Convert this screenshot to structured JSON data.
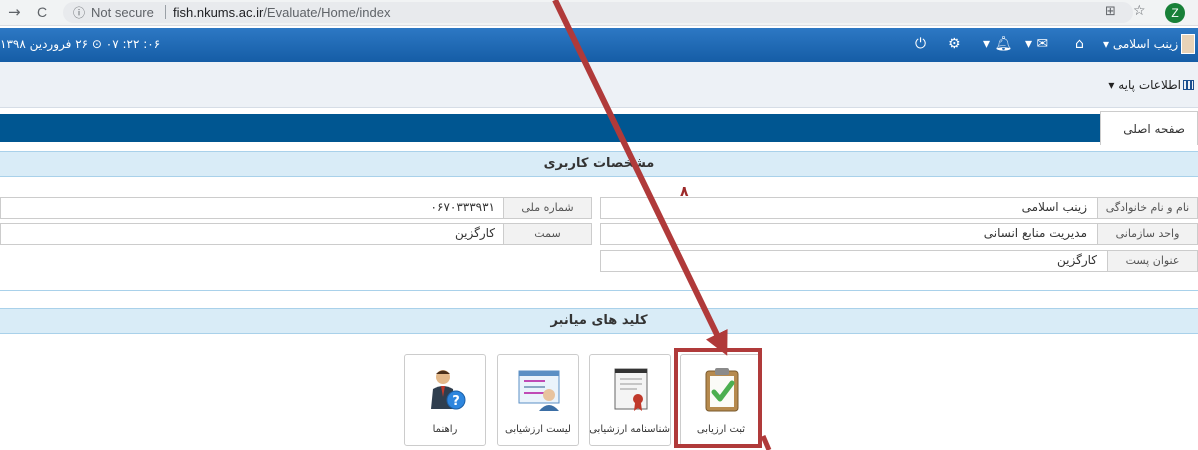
{
  "browser": {
    "back_icon": "→",
    "reload_icon": "C",
    "info_icon": "ⓘ",
    "not_secure": "Not secure",
    "url_host": "fish.nkums.ac.ir",
    "url_path": "/Evaluate/Home/index",
    "avatar_letter": "Z"
  },
  "header": {
    "user_name": "زینب اسلامی",
    "datetime": "۰۶: ۲۲: ۰۷ ⊙ ۲۶ فروردین ۱۳۹۸"
  },
  "menu": {
    "basic_info": "اطلاعات پایه"
  },
  "tabs": {
    "home": "صفحه اصلی"
  },
  "profile": {
    "title": "مشخصات کاربری",
    "full_name_label": "نام و نام خانوادگی",
    "full_name": "زینب اسلامی",
    "national_id_label": "شماره ملی",
    "national_id": "۰۶۷۰۳۳۳۹۳۱",
    "unit_label": "واحد سازمانی",
    "unit": "مدیریت منابع انسانی",
    "role_label": "سمت",
    "role": "کارگزین",
    "post_label": "عنوان پست",
    "post": "کارگزین"
  },
  "shortcuts": {
    "title": "کلید های میانبر",
    "items": [
      {
        "label": "ثبت ارزیابی",
        "icon": "clipboard-check-icon"
      },
      {
        "label": "شناسنامه ارزشیابی",
        "icon": "certificate-icon"
      },
      {
        "label": "لیست ارزشیابی",
        "icon": "list-user-icon"
      },
      {
        "label": "راهنما",
        "icon": "help-person-icon"
      }
    ]
  },
  "annotation": {
    "step_number": "۸",
    "color": "#b03a3a"
  }
}
